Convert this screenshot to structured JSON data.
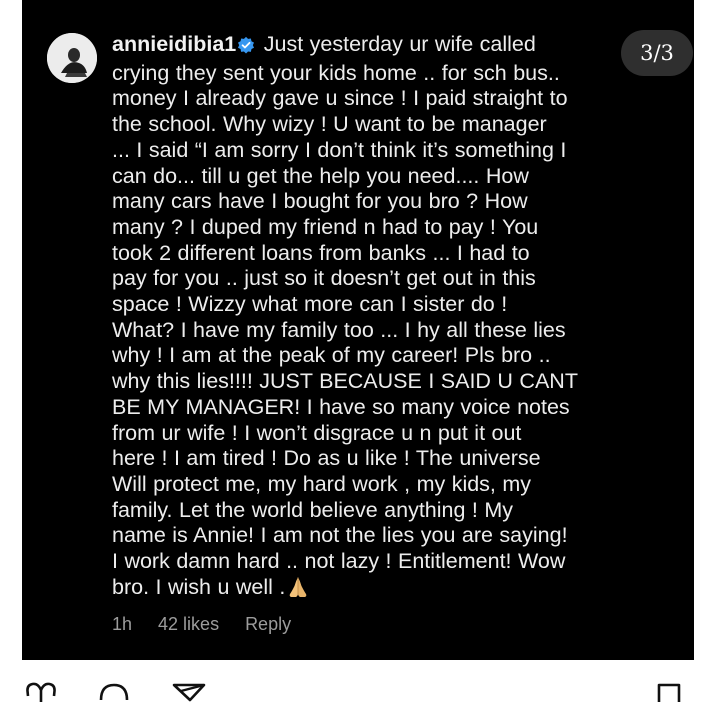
{
  "slide_counter": "3/3",
  "comment": {
    "username": "annieidibia1",
    "lines": [
      "Just yesterday ur wife called",
      "crying they sent your kids home .. for sch bus..",
      "money I already gave u since ! I paid straight to",
      "the school. Why wizy ! U want to be manager",
      "... I said “I am sorry I don’t think it’s something I",
      "can do... till u get the help you need.... How",
      "many cars have I bought for you bro ? How",
      "many ? I duped my friend n had to pay ! You",
      "took 2 different loans from banks ... I had to",
      "pay for you .. just so it doesn’t get out in this",
      "space ! Wizzy what more can I sister do !",
      "What? I have my family too ... I hy all these lies",
      "why ! I am at the peak of my career! Pls bro ..",
      "why this lies!!!! JUST BECAUSE I SAID U CANT",
      "BE MY MANAGER!  I have so many voice notes",
      "from ur wife ! I won’t disgrace u n put it out",
      "here ! I am tired ! Do as u like ! The universe",
      "Will protect me, my hard work , my kids, my",
      "family. Let the world believe anything !  My",
      "name is Annie! I am not the lies you are saying!",
      "I work damn hard .. not lazy ! Entitlement! Wow",
      "bro. I wish u well ."
    ],
    "time": "1h",
    "likes": "42 likes",
    "reply": "Reply"
  },
  "icons": {
    "verified_badge": "verified-badge-icon",
    "prayer": "folded-hands-emoji",
    "bottom_bar": [
      "heart-icon",
      "comment-icon",
      "share-icon",
      "bookmark-icon"
    ]
  },
  "colors": {
    "background": "#000000",
    "text": "#ededed",
    "meta": "#9c9c9c",
    "verified": "#3797f0"
  }
}
